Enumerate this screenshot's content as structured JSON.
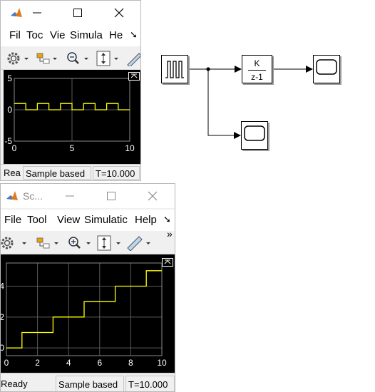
{
  "scope1": {
    "title": "",
    "menu": [
      "Fil",
      "Toc",
      "Vie",
      "Simula",
      "He"
    ],
    "more_glyph": "➘",
    "y_ticks": [
      "5",
      "0",
      "-5"
    ],
    "x_ticks": [
      "0",
      "5",
      "10"
    ],
    "status": {
      "ready": "Rea",
      "mode": "Sample based",
      "time": "T=10.000"
    }
  },
  "scope2": {
    "title": "Sc...",
    "menu": [
      "File",
      "Tool",
      "View",
      "Simulatic",
      "Help"
    ],
    "more_glyph": "➘",
    "chevron": "»",
    "y_ticks": [
      "4",
      "2",
      "0"
    ],
    "x_ticks": [
      "0",
      "2",
      "4",
      "6",
      "8",
      "10"
    ],
    "status": {
      "ready": "Ready",
      "mode": "Sample based",
      "time": "T=10.000"
    }
  },
  "model": {
    "tf_numerator": "K",
    "tf_denominator": "z-1"
  },
  "colors": {
    "signal": "#ffff00",
    "grid": "#5a5a5a",
    "plot_bg": "#000000",
    "axis_text": "#ffffff"
  },
  "chart_data": [
    {
      "type": "line",
      "title": "",
      "xlabel": "",
      "ylabel": "",
      "xlim": [
        0,
        10
      ],
      "ylim": [
        -5,
        5
      ],
      "x": [
        0,
        1,
        1,
        2,
        2,
        3,
        3,
        4,
        4,
        5,
        5,
        6,
        6,
        7,
        7,
        8,
        8,
        9,
        9,
        10
      ],
      "series": [
        {
          "values": [
            1,
            1,
            0,
            0,
            1,
            1,
            0,
            0,
            1,
            1,
            0,
            0,
            1,
            1,
            0,
            0,
            1,
            1,
            0,
            0
          ]
        }
      ],
      "grid": true
    },
    {
      "type": "line",
      "title": "",
      "xlabel": "",
      "ylabel": "",
      "xlim": [
        0,
        10
      ],
      "ylim": [
        -0.5,
        5.5
      ],
      "x": [
        0,
        1,
        1,
        3,
        3,
        5,
        5,
        7,
        7,
        9,
        9,
        10
      ],
      "series": [
        {
          "values": [
            0,
            0,
            1,
            1,
            2,
            2,
            3,
            3,
            4,
            4,
            5,
            5
          ]
        }
      ],
      "grid": true
    }
  ]
}
